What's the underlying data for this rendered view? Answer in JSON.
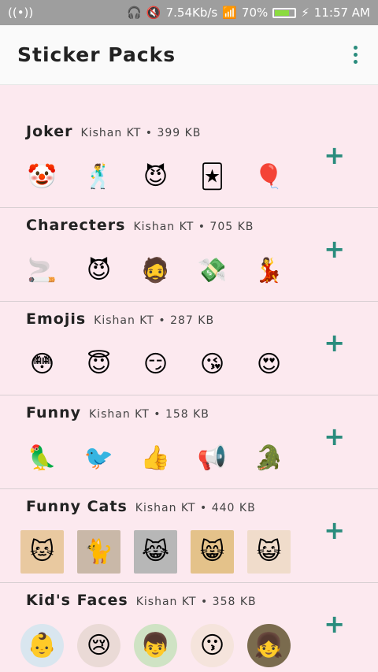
{
  "status": {
    "speed": "7.54Kb/s",
    "battery": "70%",
    "time": "11:57 AM",
    "net": "4G 4G"
  },
  "app": {
    "title": "Sticker Packs"
  },
  "packs": [
    {
      "name": "Joker",
      "meta": "Kishan KT • 399 KB",
      "stickers": [
        "🤡",
        "🕺",
        "😈",
        "🃏",
        "🎈"
      ]
    },
    {
      "name": "Charecters",
      "meta": "Kishan KT • 705 KB",
      "stickers": [
        "🚬",
        "😈",
        "🧔",
        "💸",
        "💃"
      ]
    },
    {
      "name": "Emojis",
      "meta": "Kishan KT • 287 KB",
      "stickers": [
        "😳",
        "😇",
        "😏",
        "😘",
        "😍"
      ]
    },
    {
      "name": "Funny",
      "meta": "Kishan KT • 158 KB",
      "stickers": [
        "🦜",
        "🐦",
        "👍",
        "📢",
        "🐊"
      ]
    },
    {
      "name": "Funny Cats",
      "meta": "Kishan KT • 440 KB",
      "stickers": [
        "🐱",
        "🐈",
        "😹",
        "😸",
        "😺"
      ]
    },
    {
      "name": "Kid's Faces",
      "meta": "Kishan KT • 358 KB",
      "stickers": [
        "👶",
        "😢",
        "👦",
        "😗",
        "👧"
      ]
    }
  ],
  "colors": {
    "accent": "#2a8c7d",
    "bg": "#fce9ef",
    "appbar": "#fafafa",
    "status": "#9e9e9e"
  }
}
